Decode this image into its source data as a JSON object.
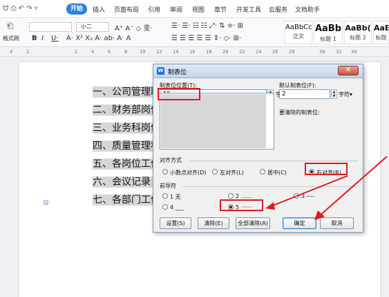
{
  "menubar": {
    "tabs": [
      "开始",
      "插入",
      "页面布局",
      "引用",
      "审阅",
      "视图",
      "章节",
      "开发工具",
      "云服务",
      "文档助手"
    ]
  },
  "ribbon": {
    "format_painter": "格式刷",
    "font_size": "小二",
    "styles": [
      {
        "sample": "AaBbCcI",
        "label": "正文"
      },
      {
        "sample": "AaBb",
        "label": "标题 1"
      },
      {
        "sample": "AaBb(",
        "label": "标题 2"
      },
      {
        "sample": "AaBb",
        "label": "标题"
      }
    ]
  },
  "ruler": {
    "ticks": [
      "4",
      "2",
      "2",
      "4",
      "6",
      "8",
      "10",
      "12",
      "14",
      "16",
      "18",
      "20",
      "22",
      "24",
      "26",
      "28",
      "30",
      "32",
      "34"
    ]
  },
  "document": {
    "lines": [
      "一、公司管理职责",
      "二、财务部岗位要",
      "三、业务科岗位要",
      "四、质量管理科岗",
      "五、各岗位工作目",
      "六、会议记录 16",
      "七、各部门工作总"
    ]
  },
  "dialog": {
    "title": "制表位",
    "tab_pos_label": "制表位位置(T):",
    "tab_pos_value": "40",
    "default_tab_label": "默认制表位(F):",
    "default_tab_value": "2",
    "unit": "字符▾",
    "to_clear_label": "要清除的制表位:",
    "alignment_label": "对齐方式",
    "alignment_options": [
      "小数点对齐(D)",
      "左对齐(L)",
      "居中(C)",
      "右对齐(R)"
    ],
    "leader_label": "前导符",
    "leader_options": [
      "1 无",
      "2 ......",
      "3 ----",
      "4 ___",
      "5 ······"
    ],
    "buttons": {
      "set": "设置(S)",
      "clear": "清除(E)",
      "clear_all": "全部清除(A)",
      "ok": "确定",
      "cancel": "取消"
    }
  }
}
